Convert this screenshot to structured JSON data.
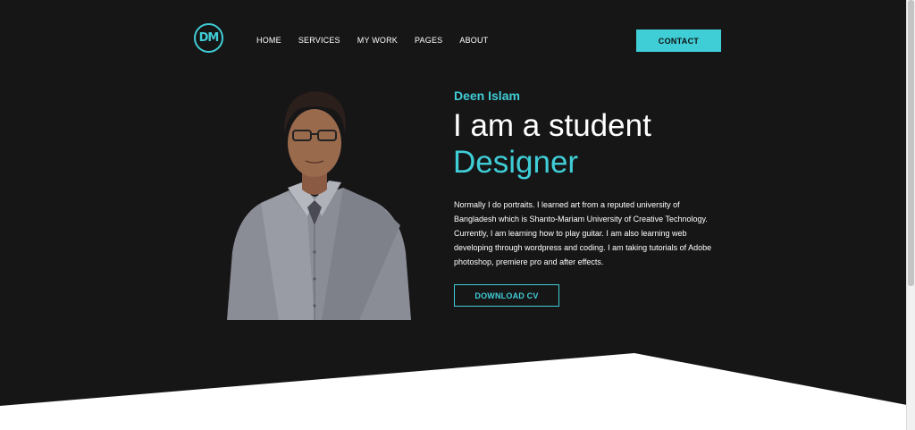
{
  "header": {
    "logo_text": "DM",
    "nav": [
      "HOME",
      "SERVICES",
      "MY WORK",
      "PAGES",
      "ABOUT"
    ],
    "contact_label": "CONTACT"
  },
  "hero": {
    "name": "Deen Islam",
    "line1": "I am a student",
    "line2": "Designer",
    "description": "Normally I do portraits. I learned art from a reputed university of Bangladesh which is Shanto-Mariam University of Creative Technology. Currently, I am learning how to play guitar. I am also learning web developing through wordpress and coding. I am taking tutorials of Adobe photoshop, premiere pro and after effects.",
    "download_label": "DOWNLOAD CV"
  },
  "colors": {
    "background": "#171617",
    "accent": "#3fcdd6",
    "text": "#ffffff",
    "section_below": "#ffffff"
  },
  "icons": {
    "logo": "dm-logo-icon"
  }
}
